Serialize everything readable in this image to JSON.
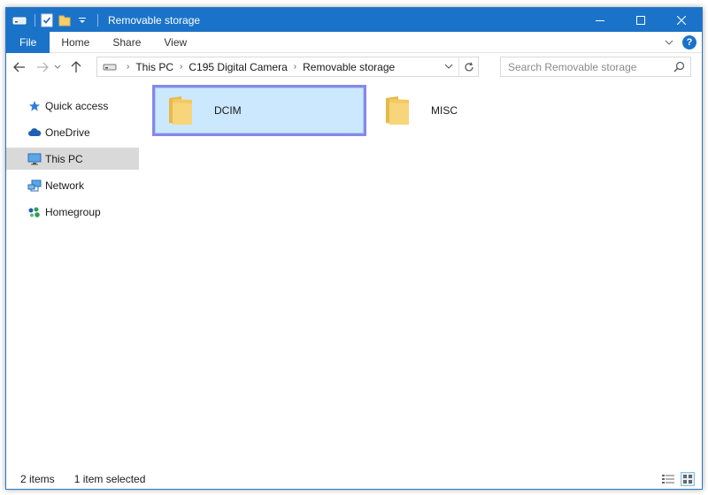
{
  "window": {
    "title": "Removable storage"
  },
  "quick_access_toolbar": {
    "icons": [
      "drive-icon",
      "properties-check-icon",
      "new-folder-icon",
      "customize-dropdown-icon"
    ]
  },
  "window_controls": {
    "minimize": "—",
    "maximize": "☐",
    "close": "✕"
  },
  "ribbon": {
    "tabs": [
      {
        "label": "File",
        "active": true
      },
      {
        "label": "Home"
      },
      {
        "label": "Share"
      },
      {
        "label": "View"
      }
    ],
    "help": "?"
  },
  "address_bar": {
    "crumbs": [
      "This PC",
      "C195 Digital Camera",
      "Removable storage"
    ]
  },
  "search": {
    "placeholder": "Search Removable storage"
  },
  "nav_pane": {
    "items": [
      {
        "label": "Quick access",
        "icon": "star-icon"
      },
      {
        "label": "OneDrive",
        "icon": "cloud-icon"
      },
      {
        "label": "This PC",
        "icon": "monitor-icon",
        "selected": true
      },
      {
        "label": "Network",
        "icon": "network-icon"
      },
      {
        "label": "Homegroup",
        "icon": "homegroup-icon"
      }
    ]
  },
  "content": {
    "folders": [
      {
        "name": "DCIM",
        "selected": true
      },
      {
        "name": "MISC",
        "selected": false
      }
    ]
  },
  "status_bar": {
    "item_count": "2 items",
    "selection": "1 item selected"
  },
  "colors": {
    "accent": "#1a73c9",
    "selection_fill": "#cce8ff",
    "highlight_outline": "#8b86e8",
    "folder_yellow": "#f5cf6b"
  }
}
